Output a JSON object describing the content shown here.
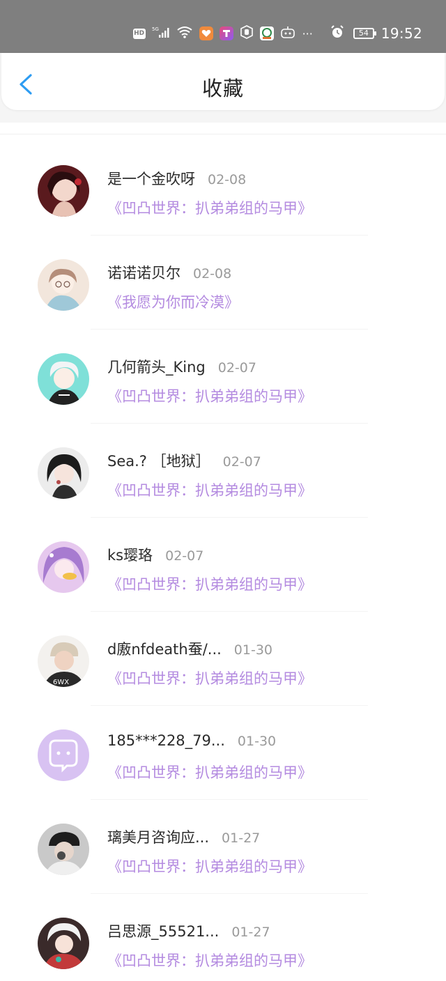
{
  "status_bar": {
    "hd": "HD",
    "net": "5G",
    "more": "···",
    "battery": "54",
    "time": "19:52"
  },
  "header": {
    "title": "收藏"
  },
  "favorites": [
    {
      "name": "是一个金吹呀",
      "date": "02-08",
      "work": "《凹凸世界：扒弟弟组的马甲》"
    },
    {
      "name": "诺诺诺贝尔",
      "date": "02-08",
      "work": "《我愿为你而冷漠》"
    },
    {
      "name": "几何箭头_King",
      "date": "02-07",
      "work": "《凹凸世界：扒弟弟组的马甲》"
    },
    {
      "name": "Sea.? ［地狱］",
      "date": "02-07",
      "work": "《凹凸世界：扒弟弟组的马甲》"
    },
    {
      "name": "ks璎珞",
      "date": "02-07",
      "work": "《凹凸世界：扒弟弟组的马甲》"
    },
    {
      "name": "d廒nfdeath蚕/...",
      "date": "01-30",
      "work": "《凹凸世界：扒弟弟组的马甲》"
    },
    {
      "name": "185***228_79...",
      "date": "01-30",
      "work": "《凹凸世界：扒弟弟组的马甲》"
    },
    {
      "name": "璃美月咨询应...",
      "date": "01-27",
      "work": "《凹凸世界：扒弟弟组的马甲》"
    },
    {
      "name": "吕思源_55521...",
      "date": "01-27",
      "work": "《凹凸世界：扒弟弟组的马甲》"
    }
  ],
  "colors": {
    "accent": "#2d9cf2",
    "work_title": "#b48be0",
    "status_bar": "#7f7f7f"
  }
}
